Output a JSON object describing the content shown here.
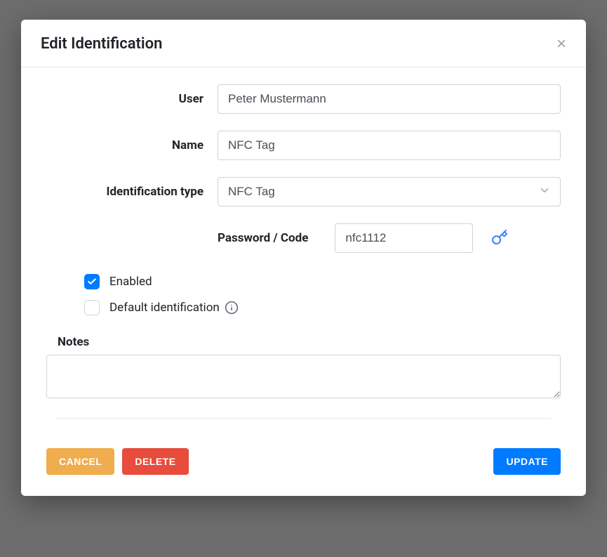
{
  "modal": {
    "title": "Edit Identification",
    "fields": {
      "user": {
        "label": "User",
        "value": "Peter Mustermann"
      },
      "name": {
        "label": "Name",
        "value": "NFC Tag"
      },
      "idtype": {
        "label": "Identification type",
        "value": "NFC Tag"
      },
      "password": {
        "label": "Password / Code",
        "value": "nfc1112"
      }
    },
    "checkboxes": {
      "enabled": {
        "label": "Enabled",
        "checked": true
      },
      "default_identification": {
        "label": "Default identification",
        "checked": false
      }
    },
    "notes": {
      "label": "Notes",
      "value": ""
    },
    "buttons": {
      "cancel": "CANCEL",
      "delete": "DELETE",
      "update": "UPDATE"
    }
  }
}
